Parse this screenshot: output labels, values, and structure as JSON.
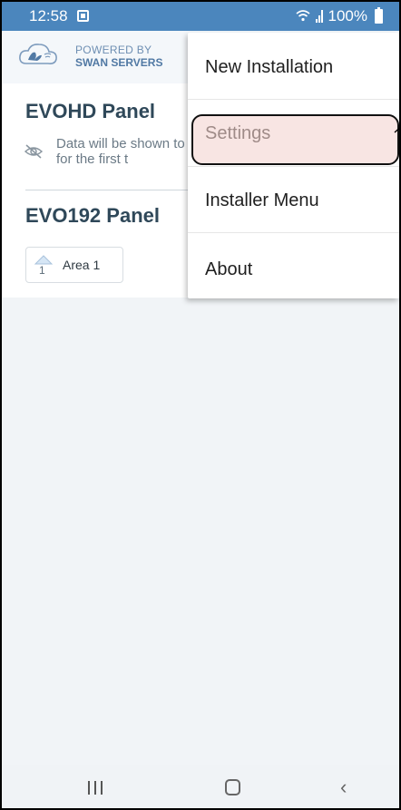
{
  "status_bar": {
    "time": "12:58",
    "battery": "100%",
    "icons": [
      "notification-square-icon",
      "wifi-icon",
      "signal-icon",
      "battery-icon"
    ]
  },
  "brand": {
    "line1": "POWERED BY",
    "line2": "SWAN SERVERS",
    "logo_icon": "swan-cloud-logo"
  },
  "panels": [
    {
      "title": "EVOHD Panel",
      "notice": "Data will be shown to site for the first t",
      "notice_icon": "eye-off-icon"
    },
    {
      "title": "EVO192 Panel",
      "areas": [
        {
          "number": "1",
          "label": "Area 1",
          "icon": "home-icon"
        }
      ]
    }
  ],
  "menu": {
    "items": [
      {
        "label": "New Installation"
      },
      {
        "label": "Settings",
        "highlighted": true
      },
      {
        "label": "Installer Menu"
      },
      {
        "label": "About"
      }
    ]
  },
  "nav_bar": {
    "icons": [
      "recents-icon",
      "home-button-icon",
      "back-icon"
    ]
  },
  "colors": {
    "status_bar": "#4b86bd",
    "panel_title": "#2f4859",
    "brand": "#5179a4",
    "highlight_fill": "#f8e5e3"
  }
}
